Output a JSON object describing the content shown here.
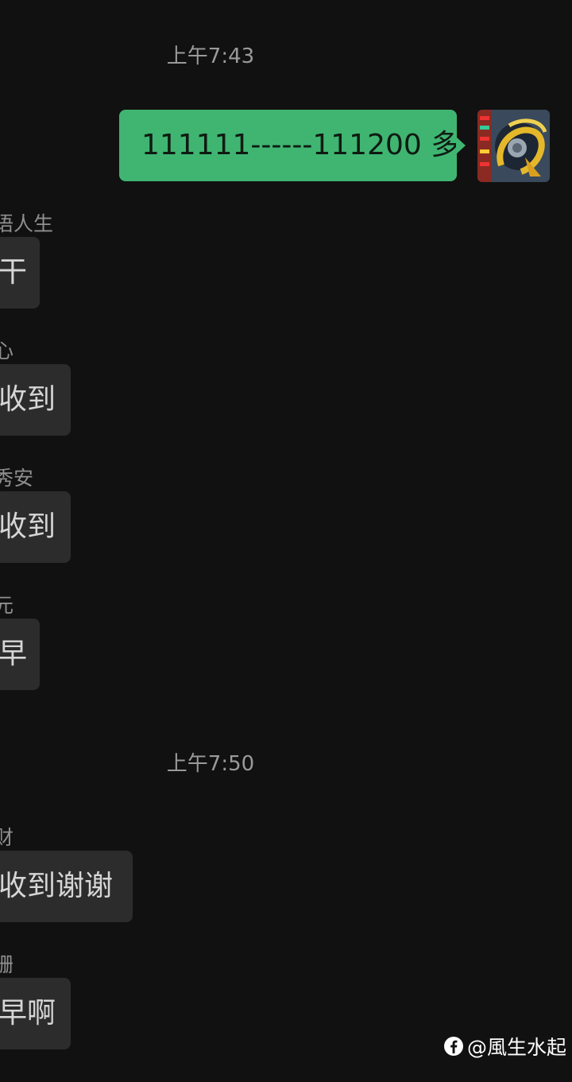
{
  "chat": {
    "timestamp_1": "上午7:43",
    "outgoing_message": "111111------111200 多",
    "messages_group_1": [
      {
        "sender": "语人生",
        "text": "干"
      },
      {
        "sender": "心",
        "text": "收到"
      },
      {
        "sender": "秀安",
        "text": "收到"
      },
      {
        "sender": "元",
        "text": "早"
      }
    ],
    "timestamp_2": "上午7:50",
    "messages_group_2": [
      {
        "sender": "财",
        "text": "收到谢谢"
      },
      {
        "sender": "珊",
        "text": "早啊"
      }
    ]
  },
  "watermark": {
    "text": "@風生水起",
    "icon": "facebook-icon"
  },
  "colors": {
    "background": "#111111",
    "outgoing_bubble": "#3fb571",
    "incoming_bubble": "#2c2c2c"
  }
}
